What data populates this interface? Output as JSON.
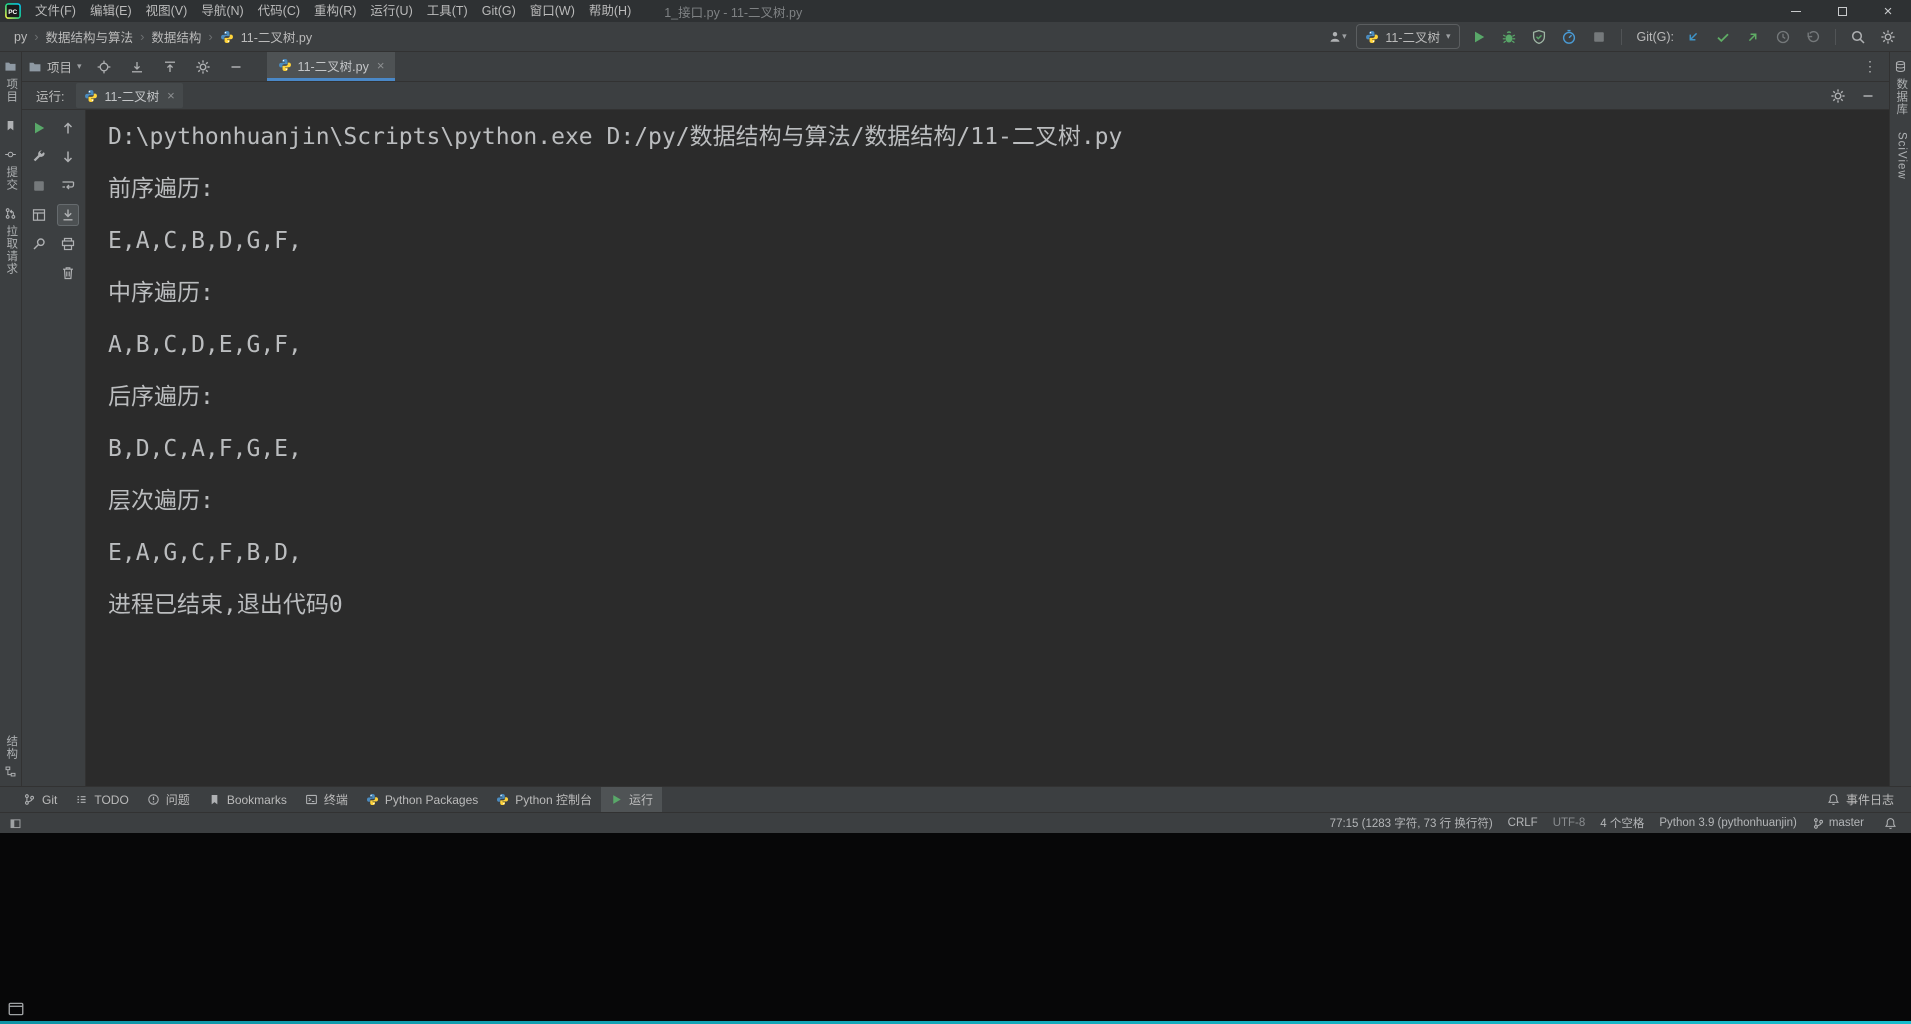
{
  "window": {
    "title": "1_接口.py - 11-二叉树.py",
    "menus": [
      "文件(F)",
      "编辑(E)",
      "视图(V)",
      "导航(N)",
      "代码(C)",
      "重构(R)",
      "运行(U)",
      "工具(T)",
      "Git(G)",
      "窗口(W)",
      "帮助(H)"
    ]
  },
  "navbar": {
    "breadcrumbs": [
      "py",
      "数据结构与算法",
      "数据结构",
      "11-二叉树.py"
    ],
    "run_config": "11-二叉树",
    "git_label": "Git(G):"
  },
  "project_panel": {
    "title": "项目"
  },
  "editor": {
    "tab": "11-二叉树.py"
  },
  "run_panel": {
    "label": "运行:",
    "tab": "11-二叉树"
  },
  "console": {
    "lines": [
      "D:\\pythonhuanjin\\Scripts\\python.exe D:/py/数据结构与算法/数据结构/11-二叉树.py",
      "",
      "前序遍历:",
      "",
      "E,A,C,B,D,G,F,",
      "",
      "中序遍历:",
      "",
      "A,B,C,D,E,G,F,",
      "",
      "后序遍历:",
      "",
      "B,D,C,A,F,G,E,",
      "",
      "层次遍历:",
      "",
      "E,A,G,C,F,B,D,",
      "",
      "进程已结束,退出代码0"
    ]
  },
  "left_stripe": {
    "project": "项目",
    "commit": "提交",
    "pull_requests": "拉取请求",
    "structure": "结构"
  },
  "right_stripe": {
    "database": "数据库",
    "sciview": "SciView"
  },
  "bottom_bar": {
    "tabs": [
      {
        "label": "Git"
      },
      {
        "label": "TODO"
      },
      {
        "label": "问题"
      },
      {
        "label": "Bookmarks"
      },
      {
        "label": "终端"
      },
      {
        "label": "Python Packages"
      },
      {
        "label": "Python 控制台"
      },
      {
        "label": "运行"
      }
    ],
    "active_tab": "运行",
    "event_log": "事件日志"
  },
  "status_bar": {
    "caret_info": "77:15 (1283 字符, 73 行 换行符)",
    "line_separator": "CRLF",
    "encoding": "UTF-8",
    "indent": "4 个空格",
    "interpreter": "Python 3.9 (pythonhuanjin)",
    "branch": "master"
  },
  "glyphs": {
    "close": "×",
    "dropdown": "▾",
    "chevron": "›",
    "kebab": "⋮",
    "logo": "PC"
  },
  "colors": {
    "accent_green": "#59a869",
    "tab_underline": "#4a88c7",
    "panel_bg": "#3c3f41",
    "console_bg": "#2b2b2b",
    "taskbar_accent": "#14a3b4"
  }
}
